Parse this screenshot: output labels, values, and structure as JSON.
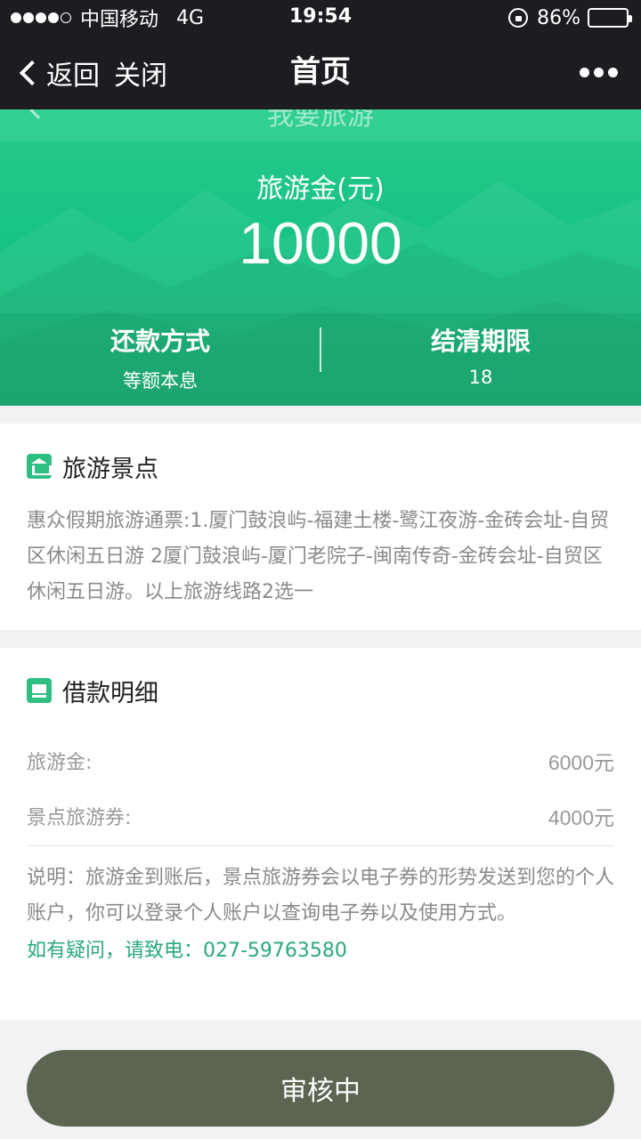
{
  "status_bar": {
    "carrier": "中国移动",
    "network": "4G",
    "time": "19:54",
    "battery_percent": "86%",
    "icons": [
      "signal-dots-icon",
      "rotation-lock-icon",
      "battery-icon"
    ]
  },
  "nav": {
    "back_label": "返回",
    "close_label": "关闭",
    "title": "首页",
    "more_icon": "more-dots-icon"
  },
  "hero": {
    "ghost_title": "我要旅游",
    "label": "旅游金(元)",
    "amount": "10000",
    "repayment_title": "还款方式",
    "repayment_value": "等额本息",
    "term_title": "结清期限",
    "term_value": "18",
    "colors": {
      "primary": "#17c383",
      "light": "#34cf92"
    }
  },
  "scenic": {
    "icon": "temple-icon",
    "title": "旅游景点",
    "description": "惠众假期旅游通票:1.厦门鼓浪屿-福建土楼-鹭江夜游-金砖会址-自贸区休闲五日游 2厦门鼓浪屿-厦门老院子-闽南传奇-金砖会址-自贸区休闲五日游。以上旅游线路2选一"
  },
  "loan": {
    "icon": "document-icon",
    "title": "借款明细",
    "rows": [
      {
        "label": "旅游金:",
        "value": "6000元"
      },
      {
        "label": "景点旅游券:",
        "value": "4000元"
      }
    ],
    "note": "说明：旅游金到账后，景点旅游券会以电子券的形势发送到您的个人账户，你可以登录个人账户以查询电子券以及使用方式。",
    "phone": "如有疑问，请致电：027-59763580",
    "accent_color": "#2aa97a"
  },
  "button": {
    "label": "审核中",
    "color": "#5c6551"
  }
}
